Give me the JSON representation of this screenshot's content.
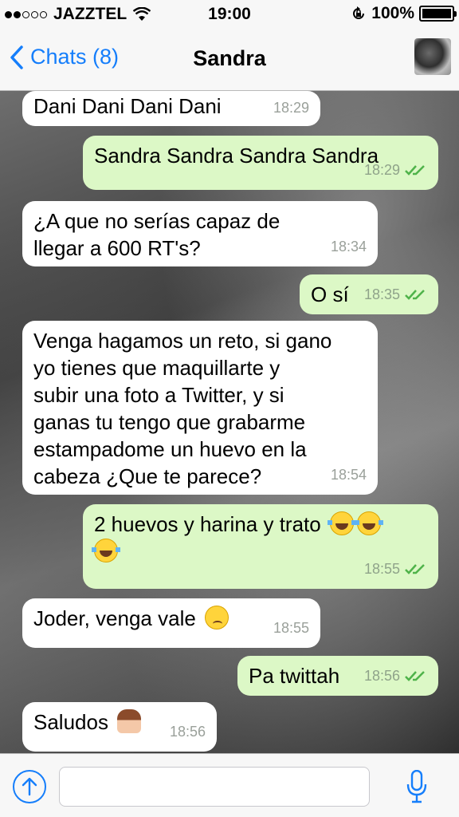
{
  "status_bar": {
    "carrier": "JAZZTEL",
    "time": "19:00",
    "battery": "100%",
    "signal_bars": 2,
    "signal_total": 5
  },
  "nav": {
    "back_label": "Chats (8)",
    "title": "Sandra"
  },
  "messages": [
    {
      "direction": "in",
      "text": "Dani Dani Dani Dani",
      "time": "18:29"
    },
    {
      "direction": "out",
      "text": "Sandra Sandra Sandra Sandra",
      "time": "18:29"
    },
    {
      "direction": "in",
      "text": "¿A que no serías capaz de\nllegar a 600 RT's?",
      "time": "18:34"
    },
    {
      "direction": "out",
      "text": "O sí",
      "time": "18:35"
    },
    {
      "direction": "in",
      "text": "Venga hagamos un reto, si gano\nyo tienes que maquillarte y\nsubir una foto a Twitter, y si\nganas tu tengo que grabarme\nestampadome un huevo en la\ncabeza ¿Que te parece?",
      "time": "18:54"
    },
    {
      "direction": "out",
      "text": "2 huevos y harina y trato",
      "time": "18:55"
    },
    {
      "direction": "in",
      "text": "Joder, venga vale",
      "time": "18:55"
    },
    {
      "direction": "out",
      "text": "Pa twittah",
      "time": "18:56"
    },
    {
      "direction": "in",
      "text": "Saludos",
      "time": "18:56"
    }
  ],
  "input": {
    "placeholder": ""
  },
  "colors": {
    "accent": "#157efb",
    "incoming_bubble": "#ffffff",
    "outgoing_bubble": "#dcf8c6",
    "read_ticks": "#4fb34a"
  },
  "icons": {
    "back": "chevron-left-icon",
    "upload": "upload-arrow-icon",
    "mic": "microphone-icon",
    "ticks": "double-check-icon"
  }
}
